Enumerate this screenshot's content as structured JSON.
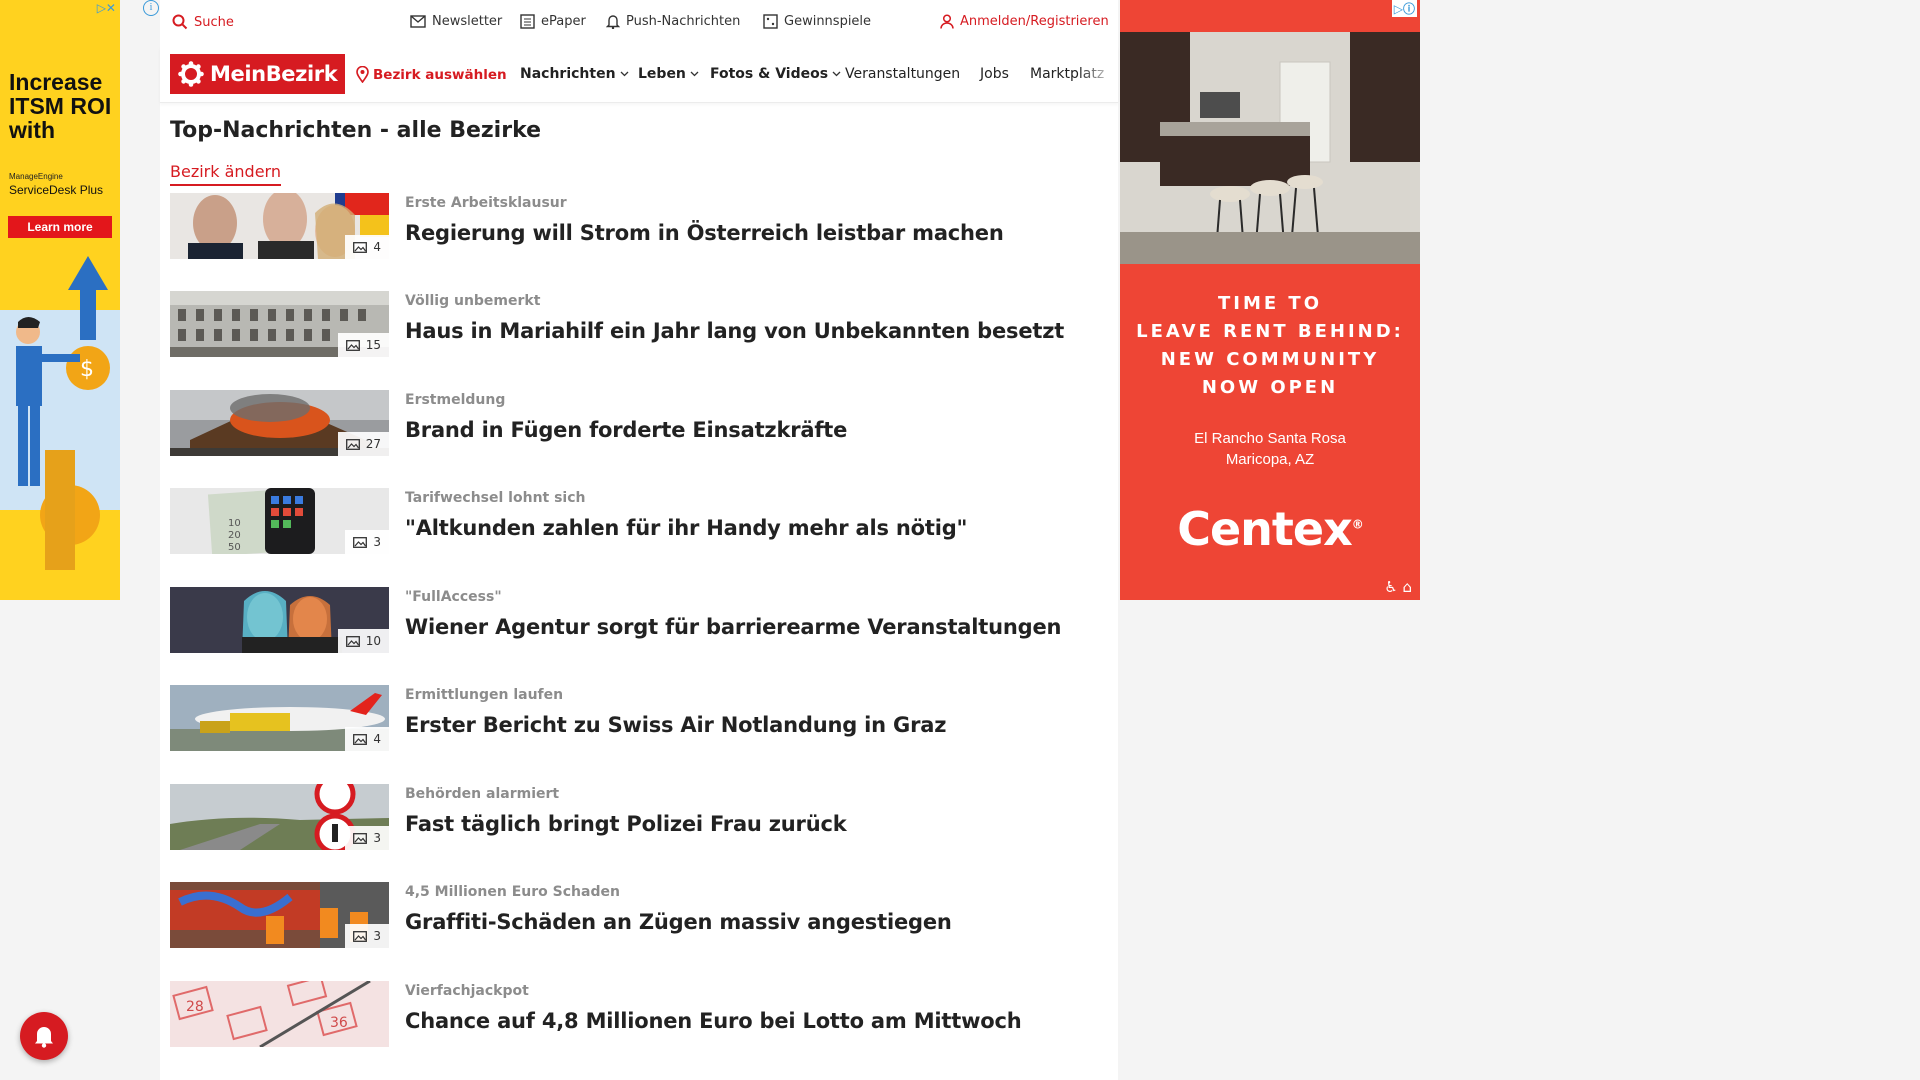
{
  "ad_left": {
    "adchoices": "▷✕",
    "headline": "Increase ITSM ROI with",
    "brand_small": "ManageEngine",
    "brand": "ServiceDesk Plus",
    "cta": "Learn more",
    "colors": {
      "bg": "#ffd21f",
      "cta": "#e3161b"
    }
  },
  "topbar": {
    "search": "Suche",
    "newsletter": "Newsletter",
    "epaper": "ePaper",
    "push": "Push-Nachrichten",
    "gewinnspiele": "Gewinnspiele",
    "login": "Anmelden/Registrieren"
  },
  "nav": {
    "logo": "MeinBezirk",
    "district": "Bezirk auswählen",
    "items": [
      "Nachrichten",
      "Leben",
      "Fotos & Videos",
      "Veranstaltungen",
      "Jobs",
      "Marktplatz"
    ]
  },
  "section": {
    "title": "Top-Nachrichten - alle Bezirke",
    "change_link": "Bezirk ändern"
  },
  "articles": [
    {
      "kicker": "Erste Arbeitsklausur",
      "title": "Regierung will Strom in Österreich leistbar machen",
      "photos": "4"
    },
    {
      "kicker": "Völlig unbemerkt",
      "title": "Haus in Mariahilf ein Jahr lang von Unbekannten besetzt",
      "photos": "15"
    },
    {
      "kicker": "Erstmeldung",
      "title": "Brand in Fügen forderte Einsatzkräfte",
      "photos": "27"
    },
    {
      "kicker": "Tarifwechsel lohnt sich",
      "title": "\"Altkunden zahlen für ihr Handy mehr als nötig\"",
      "photos": "3"
    },
    {
      "kicker": "\"FullAccess\"",
      "title": "Wiener Agentur sorgt für barrierearme Veranstaltungen",
      "photos": "10"
    },
    {
      "kicker": "Ermittlungen laufen",
      "title": "Erster Bericht zu Swiss Air Notlandung in Graz",
      "photos": "4"
    },
    {
      "kicker": "Behörden alarmiert",
      "title": "Fast täglich bringt Polizei Frau zurück",
      "photos": "3"
    },
    {
      "kicker": "4,5 Millionen Euro Schaden",
      "title": "Graffiti-Schäden an Zügen massiv angestiegen",
      "photos": "3"
    },
    {
      "kicker": "Vierfachjackpot",
      "title": "Chance auf 4,8 Millionen Euro bei Lotto am Mittwoch",
      "photos": ""
    }
  ],
  "ad_right": {
    "tagline": [
      "TIME TO",
      "LEAVE RENT BEHIND:",
      "NEW COMMUNITY",
      "NOW OPEN"
    ],
    "location_1": "El Rancho Santa Rosa",
    "location_2": "Maricopa, AZ",
    "brand": "Centex",
    "colors": {
      "bg": "#ee4535"
    }
  },
  "colors": {
    "accent": "#d61b21",
    "kicker": "#8c8c8c"
  }
}
